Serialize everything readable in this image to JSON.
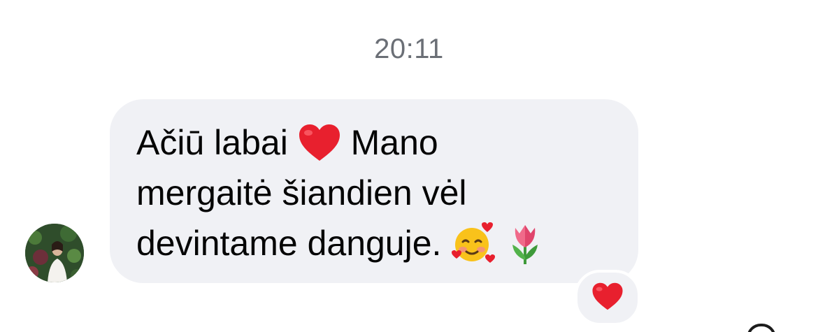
{
  "chat": {
    "timestamp": "20:11",
    "message": {
      "line1_part1": "Ačiū labai",
      "line1_part2": "Mano",
      "line2": "mergaitė šiandien vėl",
      "line3": "devintame danguje.",
      "emojis": [
        "red-heart-emoji",
        "smiling-face-with-hearts-emoji",
        "tulip-emoji"
      ]
    },
    "reaction": {
      "emoji": "red-heart-emoji"
    }
  },
  "colors": {
    "bubble": "#f0f1f5",
    "timestamp": "#6b6f76",
    "text": "#050505",
    "heart": "#e8202e"
  }
}
